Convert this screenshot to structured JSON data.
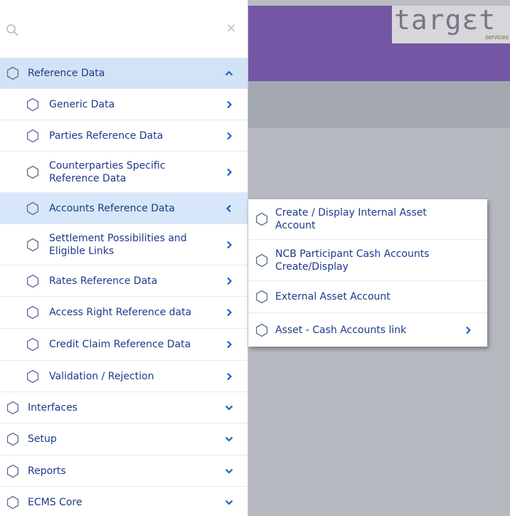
{
  "colors": {
    "header": "#7357a4",
    "subbar": "#a3a8b1",
    "accent_text": "#1d3a8a",
    "chevron": "#1a63c6",
    "active_row": "#d3e3f6"
  },
  "brand": {
    "logo_text": "targɛt",
    "logo_subtext": "services"
  },
  "search": {
    "value": "",
    "placeholder": ""
  },
  "sidebar": {
    "reference_data": {
      "label": "Reference Data",
      "icon": "hexagon-icon",
      "expanded": true,
      "children": [
        {
          "label": "Generic Data"
        },
        {
          "label": "Parties Reference Data"
        },
        {
          "label": "Counterparties Specific Reference Data"
        },
        {
          "label": "Accounts Reference Data",
          "active": true
        },
        {
          "label": "Settlement Possibilities and Eligible Links"
        },
        {
          "label": "Rates Reference Data"
        },
        {
          "label": "Access Right Reference data"
        },
        {
          "label": "Credit Claim Reference Data"
        },
        {
          "label": "Validation / Rejection"
        }
      ]
    },
    "sections": [
      {
        "label": "Interfaces"
      },
      {
        "label": "Setup"
      },
      {
        "label": "Reports"
      },
      {
        "label": "ECMS Core"
      }
    ]
  },
  "flyout": {
    "items": [
      {
        "label": "Create / Display Internal Asset Account"
      },
      {
        "label": "NCB Participant Cash Accounts Create/Display"
      },
      {
        "label": "External Asset Account"
      },
      {
        "label": "Asset - Cash Accounts link",
        "has_submenu": true
      }
    ]
  }
}
